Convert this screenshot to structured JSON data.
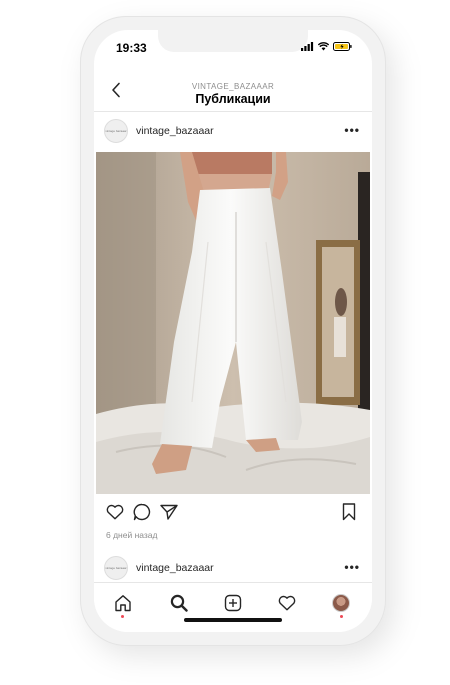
{
  "status": {
    "time": "19:33"
  },
  "nav": {
    "account": "VINTAGE_BAZAAAR",
    "title": "Публикации"
  },
  "post": {
    "username": "vintage_bazaaar",
    "avatar_text": "vintage bazaaar",
    "timestamp": "6 дней назад",
    "more": "•••"
  },
  "next_post": {
    "username": "vintage_bazaaar",
    "more": "•••"
  },
  "tabs": [
    "home",
    "search",
    "new-post",
    "activity",
    "profile"
  ],
  "icons": {
    "back": "chevron-left-icon",
    "like": "heart-icon",
    "comment": "comment-icon",
    "share": "send-icon",
    "save": "bookmark-icon"
  },
  "colors": {
    "notification_dot": "#ed4956",
    "battery": "#f5c518"
  }
}
